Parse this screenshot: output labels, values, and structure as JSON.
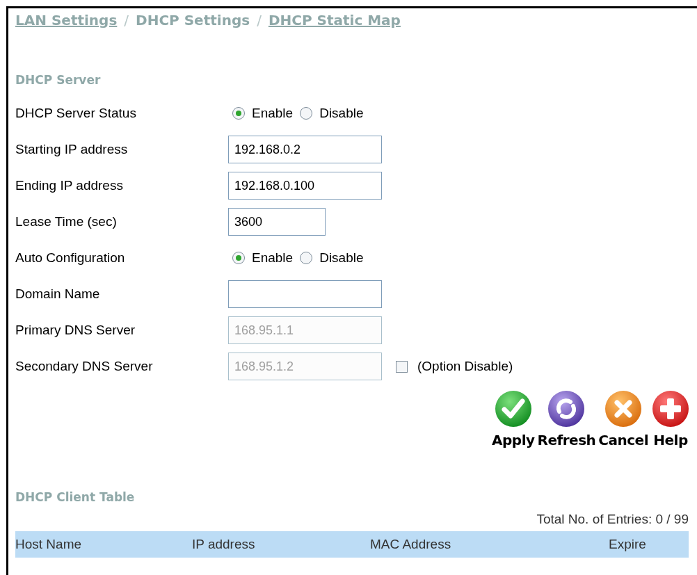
{
  "breadcrumb": [
    {
      "kind": "link",
      "label": "LAN Settings"
    },
    {
      "kind": "separator",
      "label": "/"
    },
    {
      "kind": "text",
      "label": "DHCP Settings"
    },
    {
      "kind": "separator",
      "label": "/"
    },
    {
      "kind": "link",
      "label": "DHCP Static Map"
    }
  ],
  "server": {
    "title": "DHCP Server",
    "rows": [
      {
        "kind": "radio",
        "label": "DHCP Server Status",
        "options": [
          {
            "label": "Enable",
            "selected": true
          },
          {
            "label": "Disable",
            "selected": false
          }
        ]
      },
      {
        "kind": "text",
        "label": "Starting IP address",
        "value": "192.168.0.2",
        "disabled": false
      },
      {
        "kind": "text",
        "label": "Ending IP address",
        "value": "192.168.0.100",
        "disabled": false
      },
      {
        "kind": "short_text",
        "label": "Lease Time (sec)",
        "value": "3600",
        "disabled": false
      },
      {
        "kind": "radio",
        "label": "Auto Configuration",
        "options": [
          {
            "label": "Enable",
            "selected": true
          },
          {
            "label": "Disable",
            "selected": false
          }
        ]
      },
      {
        "kind": "text",
        "label": "Domain Name",
        "disabled": false
      },
      {
        "kind": "text",
        "label": "Primary DNS Server",
        "value": "168.95.1.1",
        "disabled": true
      },
      {
        "kind": "text",
        "label": "Secondary DNS Server",
        "value": "168.95.1.2",
        "disabled": true,
        "checkbox": {
          "label": "(Option Disable)",
          "checked": false
        }
      }
    ]
  },
  "buttons": [
    {
      "kind": "apply",
      "label": "Apply"
    },
    {
      "kind": "refresh",
      "label": "Refresh"
    },
    {
      "kind": "cancel",
      "label": "Cancel"
    },
    {
      "kind": "help",
      "label": "Help"
    }
  ],
  "client_table": {
    "title": "DHCP Client Table",
    "total": "Total No. of Entries: 0 / 99",
    "columns": [
      "Host Name",
      "IP address",
      "MAC Address",
      "Expire"
    ]
  }
}
